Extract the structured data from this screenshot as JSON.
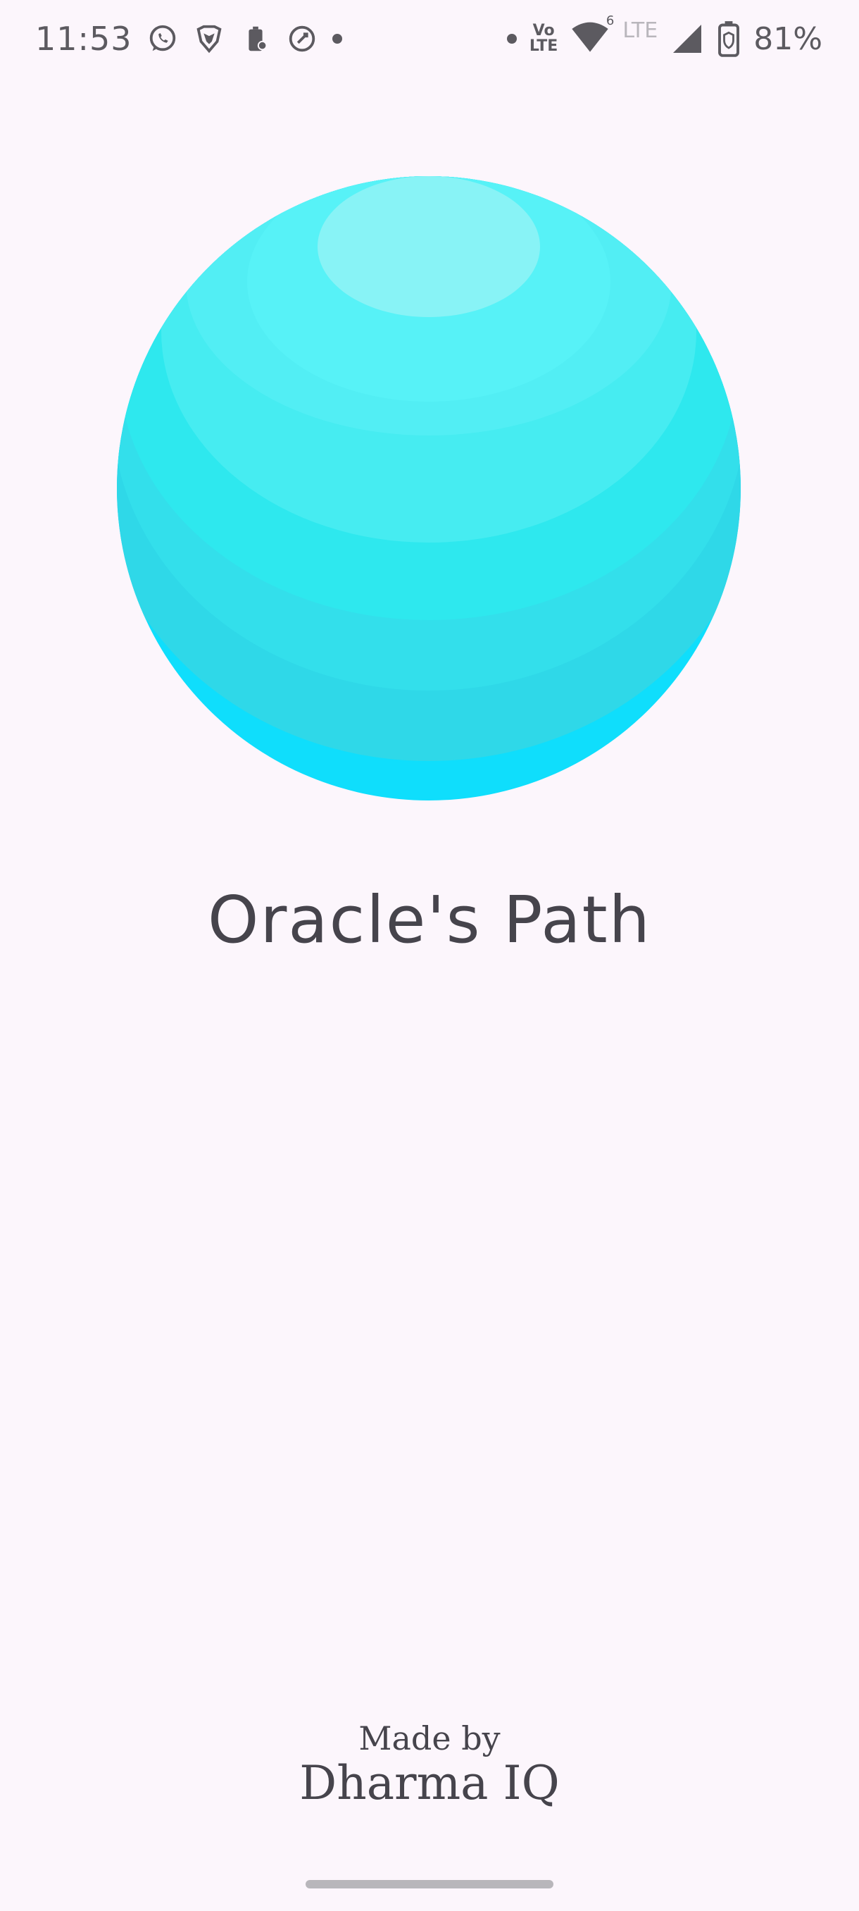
{
  "status_bar": {
    "time": "11:53",
    "network_label": "LTE",
    "volte_line1": "Vo",
    "volte_line2": "LTE",
    "wifi_badge": "6",
    "battery_percent": "81%",
    "notification_icons": [
      "whatsapp-icon",
      "brave-icon",
      "battery-saver-icon",
      "sync-app-icon",
      "more-dot-icon"
    ],
    "system_icons": [
      "dot-icon",
      "volte-icon",
      "wifi-icon",
      "signal-icon",
      "battery-icon"
    ]
  },
  "app": {
    "title": "Oracle's Path",
    "credit_prefix": "Made by",
    "credit_company": "Dharma IQ"
  },
  "colors": {
    "background": "#fcf6fc",
    "orb_primary": "#2ee8ee",
    "orb_highlight": "#88f3f6",
    "orb_edge": "#10dffc",
    "text": "#46444c"
  }
}
